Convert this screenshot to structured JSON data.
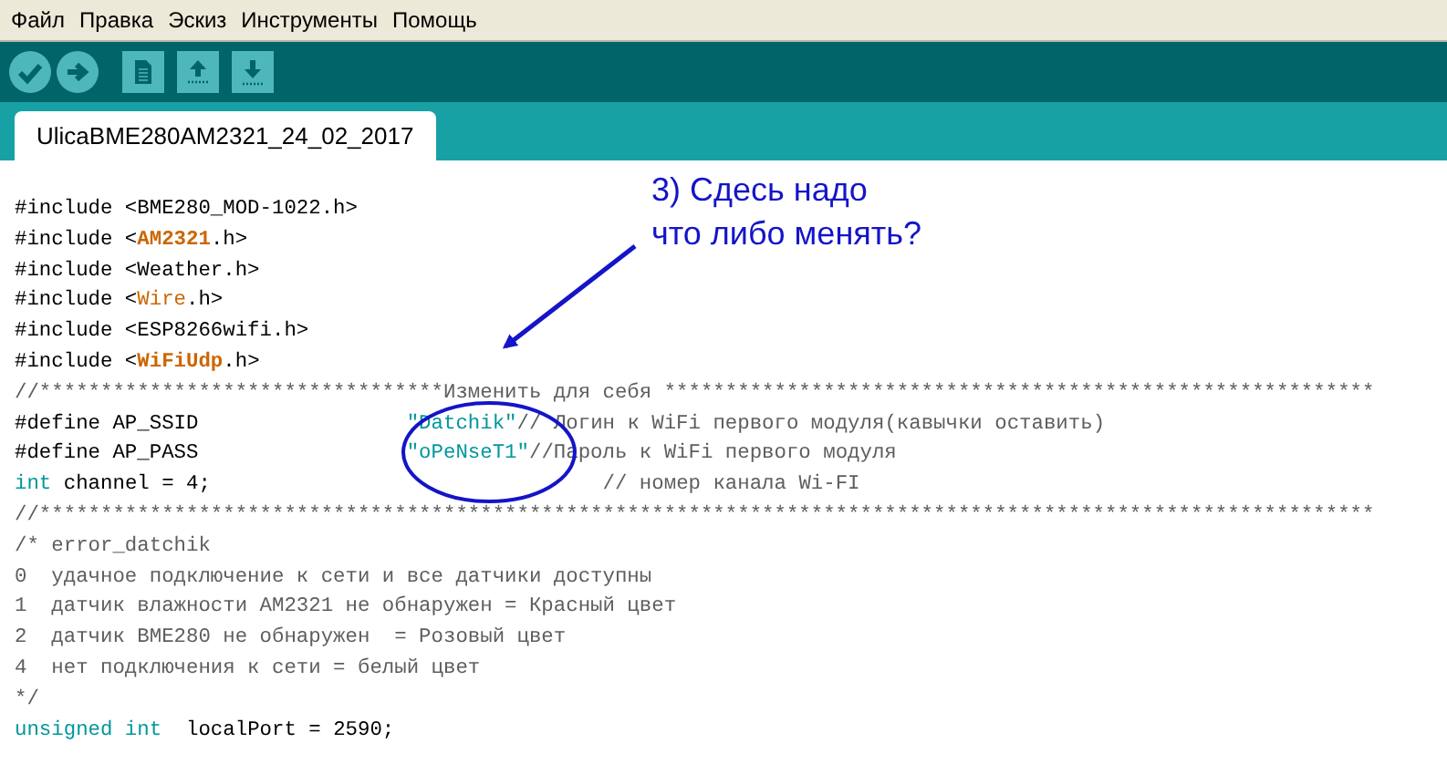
{
  "menu": [
    "Файл",
    "Правка",
    "Эскиз",
    "Инструменты",
    "Помощь"
  ],
  "tabs": [
    {
      "label": "UlicaBME280AM2321_24_02_2017",
      "selected": true
    }
  ],
  "code_lines": [
    [
      {
        "kind": "plain",
        "text": "#include <BME280_MOD-1022.h>"
      }
    ],
    [
      {
        "kind": "plain",
        "text": "#include <"
      },
      {
        "kind": "library",
        "text": "AM2321"
      },
      {
        "kind": "plain",
        "text": ".h>"
      }
    ],
    [
      {
        "kind": "plain",
        "text": "#include <Weather.h>"
      }
    ],
    [
      {
        "kind": "plain",
        "text": "#include <"
      },
      {
        "kind": "class",
        "text": "Wire"
      },
      {
        "kind": "plain",
        "text": ".h>"
      }
    ],
    [
      {
        "kind": "plain",
        "text": "#include <ESP8266wifi.h>"
      }
    ],
    [
      {
        "kind": "plain",
        "text": "#include <"
      },
      {
        "kind": "library",
        "text": "WiFiUdp"
      },
      {
        "kind": "plain",
        "text": ".h>"
      }
    ],
    [
      {
        "kind": "comment",
        "text": "//*********************************Изменить для себя **********************************************************"
      }
    ],
    [
      {
        "kind": "plain",
        "text": "#define AP_SSID                 "
      },
      {
        "kind": "string",
        "text": "\"Datchik\""
      },
      {
        "kind": "comment",
        "text": "// Логин к WiFi первого модуля(кавычки оставить)"
      }
    ],
    [
      {
        "kind": "plain",
        "text": "#define AP_PASS                 "
      },
      {
        "kind": "string",
        "text": "\"oPeNseT1\""
      },
      {
        "kind": "comment",
        "text": "//Пароль к WiFi первого модуля"
      }
    ],
    [
      {
        "kind": "keyword",
        "text": "int"
      },
      {
        "kind": "plain",
        "text": " channel = 4;                                "
      },
      {
        "kind": "comment",
        "text": "// номер канала Wi-FI"
      }
    ],
    [
      {
        "kind": "comment",
        "text": "//*************************************************************************************************************"
      }
    ],
    [
      {
        "kind": "comment",
        "text": "/* error_datchik"
      }
    ],
    [
      {
        "kind": "comment",
        "text": "0  удачное подключение к сети и все датчики доступны"
      }
    ],
    [
      {
        "kind": "comment",
        "text": "1  датчик влажности AM2321 не обнаружен = Красный цвет"
      }
    ],
    [
      {
        "kind": "comment",
        "text": "2  датчик BME280 не обнаружен  = Розовый цвет"
      }
    ],
    [
      {
        "kind": "comment",
        "text": "4  нет подключения к сети = белый цвет"
      }
    ],
    [
      {
        "kind": "comment",
        "text": "*/"
      }
    ],
    [
      {
        "kind": "keyword",
        "text": "unsigned int"
      },
      {
        "kind": "plain",
        "text": "  localPort = 2590;"
      }
    ]
  ],
  "annotation": {
    "lines": [
      "3) Сдесь надо",
      "что либо менять?"
    ]
  }
}
